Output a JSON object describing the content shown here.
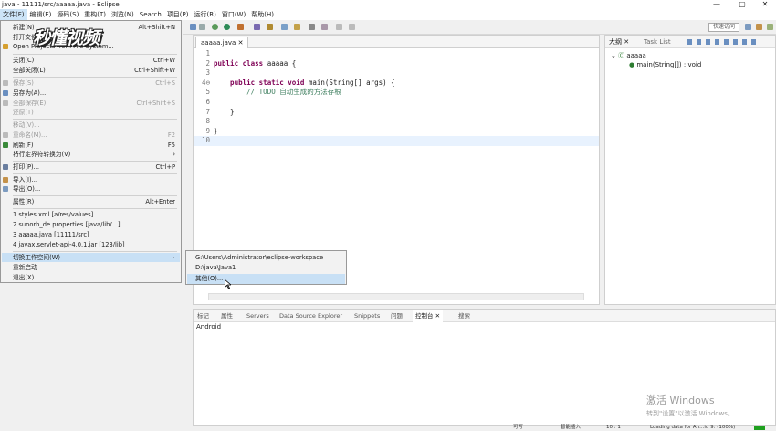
{
  "window": {
    "title": "java - 11111/src/aaaaa.java - Eclipse",
    "min": "—",
    "max": "▢",
    "close": "✕"
  },
  "menubar": [
    "文件(F)",
    "编辑(E)",
    "源码(S)",
    "重构(T)",
    "浏览(N)",
    "Search",
    "项目(P)",
    "运行(R)",
    "窗口(W)",
    "帮助(H)"
  ],
  "toolbar": {
    "quick_access": "快速访问"
  },
  "file_menu": {
    "items": [
      {
        "label": "新建(N)",
        "shortcut": "Alt+Shift+N",
        "arrow": "›"
      },
      {
        "label": "打开文件..."
      },
      {
        "label": "Open Projects from File System..."
      },
      {
        "label": "关闭(C)",
        "shortcut": "Ctrl+W"
      },
      {
        "label": "全部关闭(L)",
        "shortcut": "Ctrl+Shift+W"
      },
      {
        "label": "保存(S)",
        "shortcut": "Ctrl+S"
      },
      {
        "label": "另存为(A)..."
      },
      {
        "label": "全部保存(E)",
        "shortcut": "Ctrl+Shift+S"
      },
      {
        "label": "还原(T)"
      },
      {
        "label": "移动(V)..."
      },
      {
        "label": "重命名(M)...",
        "shortcut": "F2"
      },
      {
        "label": "刷新(F)",
        "shortcut": "F5"
      },
      {
        "label": "将行定界符转换为(V)",
        "arrow": "›"
      },
      {
        "label": "打印(P)...",
        "shortcut": "Ctrl+P"
      },
      {
        "label": "导入(I)..."
      },
      {
        "label": "导出(O)..."
      },
      {
        "label": "属性(R)",
        "shortcut": "Alt+Enter"
      },
      {
        "label": "1 styles.xml  [a/res/values]"
      },
      {
        "label": "2 sunorb_de.properties  [java/lib/...]"
      },
      {
        "label": "3 aaaaa.java  [11111/src]"
      },
      {
        "label": "4 javax.servlet-api-4.0.1.jar  [123/lib]"
      },
      {
        "label": "切换工作空间(W)",
        "arrow": "›"
      },
      {
        "label": "重新启动"
      },
      {
        "label": "退出(X)"
      }
    ]
  },
  "submenu": {
    "items": [
      "G:\\Users\\Administrator\\eclipse-workspace",
      "D:\\java\\Java1",
      "其他(O)..."
    ]
  },
  "editor": {
    "tab": "aaaaa.java ✕",
    "lines": [
      {
        "n": "1",
        "t": ""
      },
      {
        "n": "2",
        "k": "public class ",
        "t": "aaaaa {"
      },
      {
        "n": "3",
        "t": ""
      },
      {
        "n": "4⊖",
        "k": "    public static void ",
        "t": "main(String[] args) {"
      },
      {
        "n": "5",
        "c": "        // TODO 自动生成的方法存根"
      },
      {
        "n": "6",
        "t": ""
      },
      {
        "n": "7",
        "t": "    }"
      },
      {
        "n": "8",
        "t": ""
      },
      {
        "n": "9",
        "t": "}"
      },
      {
        "n": "10",
        "t": ""
      }
    ]
  },
  "outline": {
    "tabs": [
      "大纲 ✕",
      "Task List"
    ],
    "class_name": "aaaaa",
    "method": "main(String[]) : void"
  },
  "console": {
    "tabs": [
      "标记",
      "属性",
      "Servers",
      "Data Source Explorer",
      "Snippets",
      "问题",
      "控制台 ✕",
      "搜索"
    ],
    "content": "Android"
  },
  "logo": "秒懂视频",
  "watermark": {
    "line1": "激活 Windows",
    "line2": "转到\"设置\"以激活 Windows。"
  },
  "status": {
    "writable": "可写",
    "mode": "智能插入",
    "pos": "10 : 1",
    "loading": "Loading data for An...id 9: (100%)"
  },
  "colors": {
    "accent": "#cce4f7",
    "keyword": "#7f0055",
    "comment": "#3f7f5f"
  }
}
